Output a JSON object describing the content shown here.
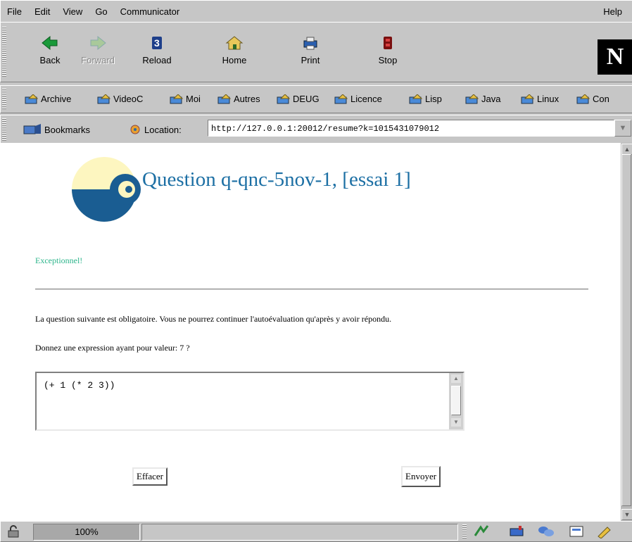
{
  "menu": {
    "items": [
      "File",
      "Edit",
      "View",
      "Go",
      "Communicator"
    ],
    "help": "Help"
  },
  "nav": {
    "back": "Back",
    "forward": "Forward",
    "reload": "Reload",
    "home": "Home",
    "print": "Print",
    "stop": "Stop",
    "logo": "N"
  },
  "personal_toolbar": [
    "Archive",
    "VideoC",
    "Moi",
    "Autres",
    "DEUG",
    "Licence",
    "Lisp",
    "Java",
    "Linux",
    "Con"
  ],
  "location": {
    "bookmarks_label": "Bookmarks",
    "location_label": "Location:",
    "url": "http://127.0.0.1:20012/resume?k=1015431079012"
  },
  "page": {
    "title": "Question q-qnc-5nov-1, [essai 1]",
    "feedback": "Exceptionnel!",
    "instruction": "La question suivante est obligatoire. Vous ne pourrez continuer l'autoévaluation qu'après y avoir répondu.",
    "prompt": "Donnez une expression ayant pour valeur: 7 ?",
    "answer": "(+ 1 (* 2 3))",
    "clear_button": "Effacer",
    "submit_button": "Envoyer"
  },
  "status": {
    "zoom": "100%"
  },
  "colors": {
    "title": "#1c6fa4",
    "feedback": "#2bb48a",
    "logo_dark": "#1a5d92",
    "logo_light": "#fdf6c0"
  }
}
